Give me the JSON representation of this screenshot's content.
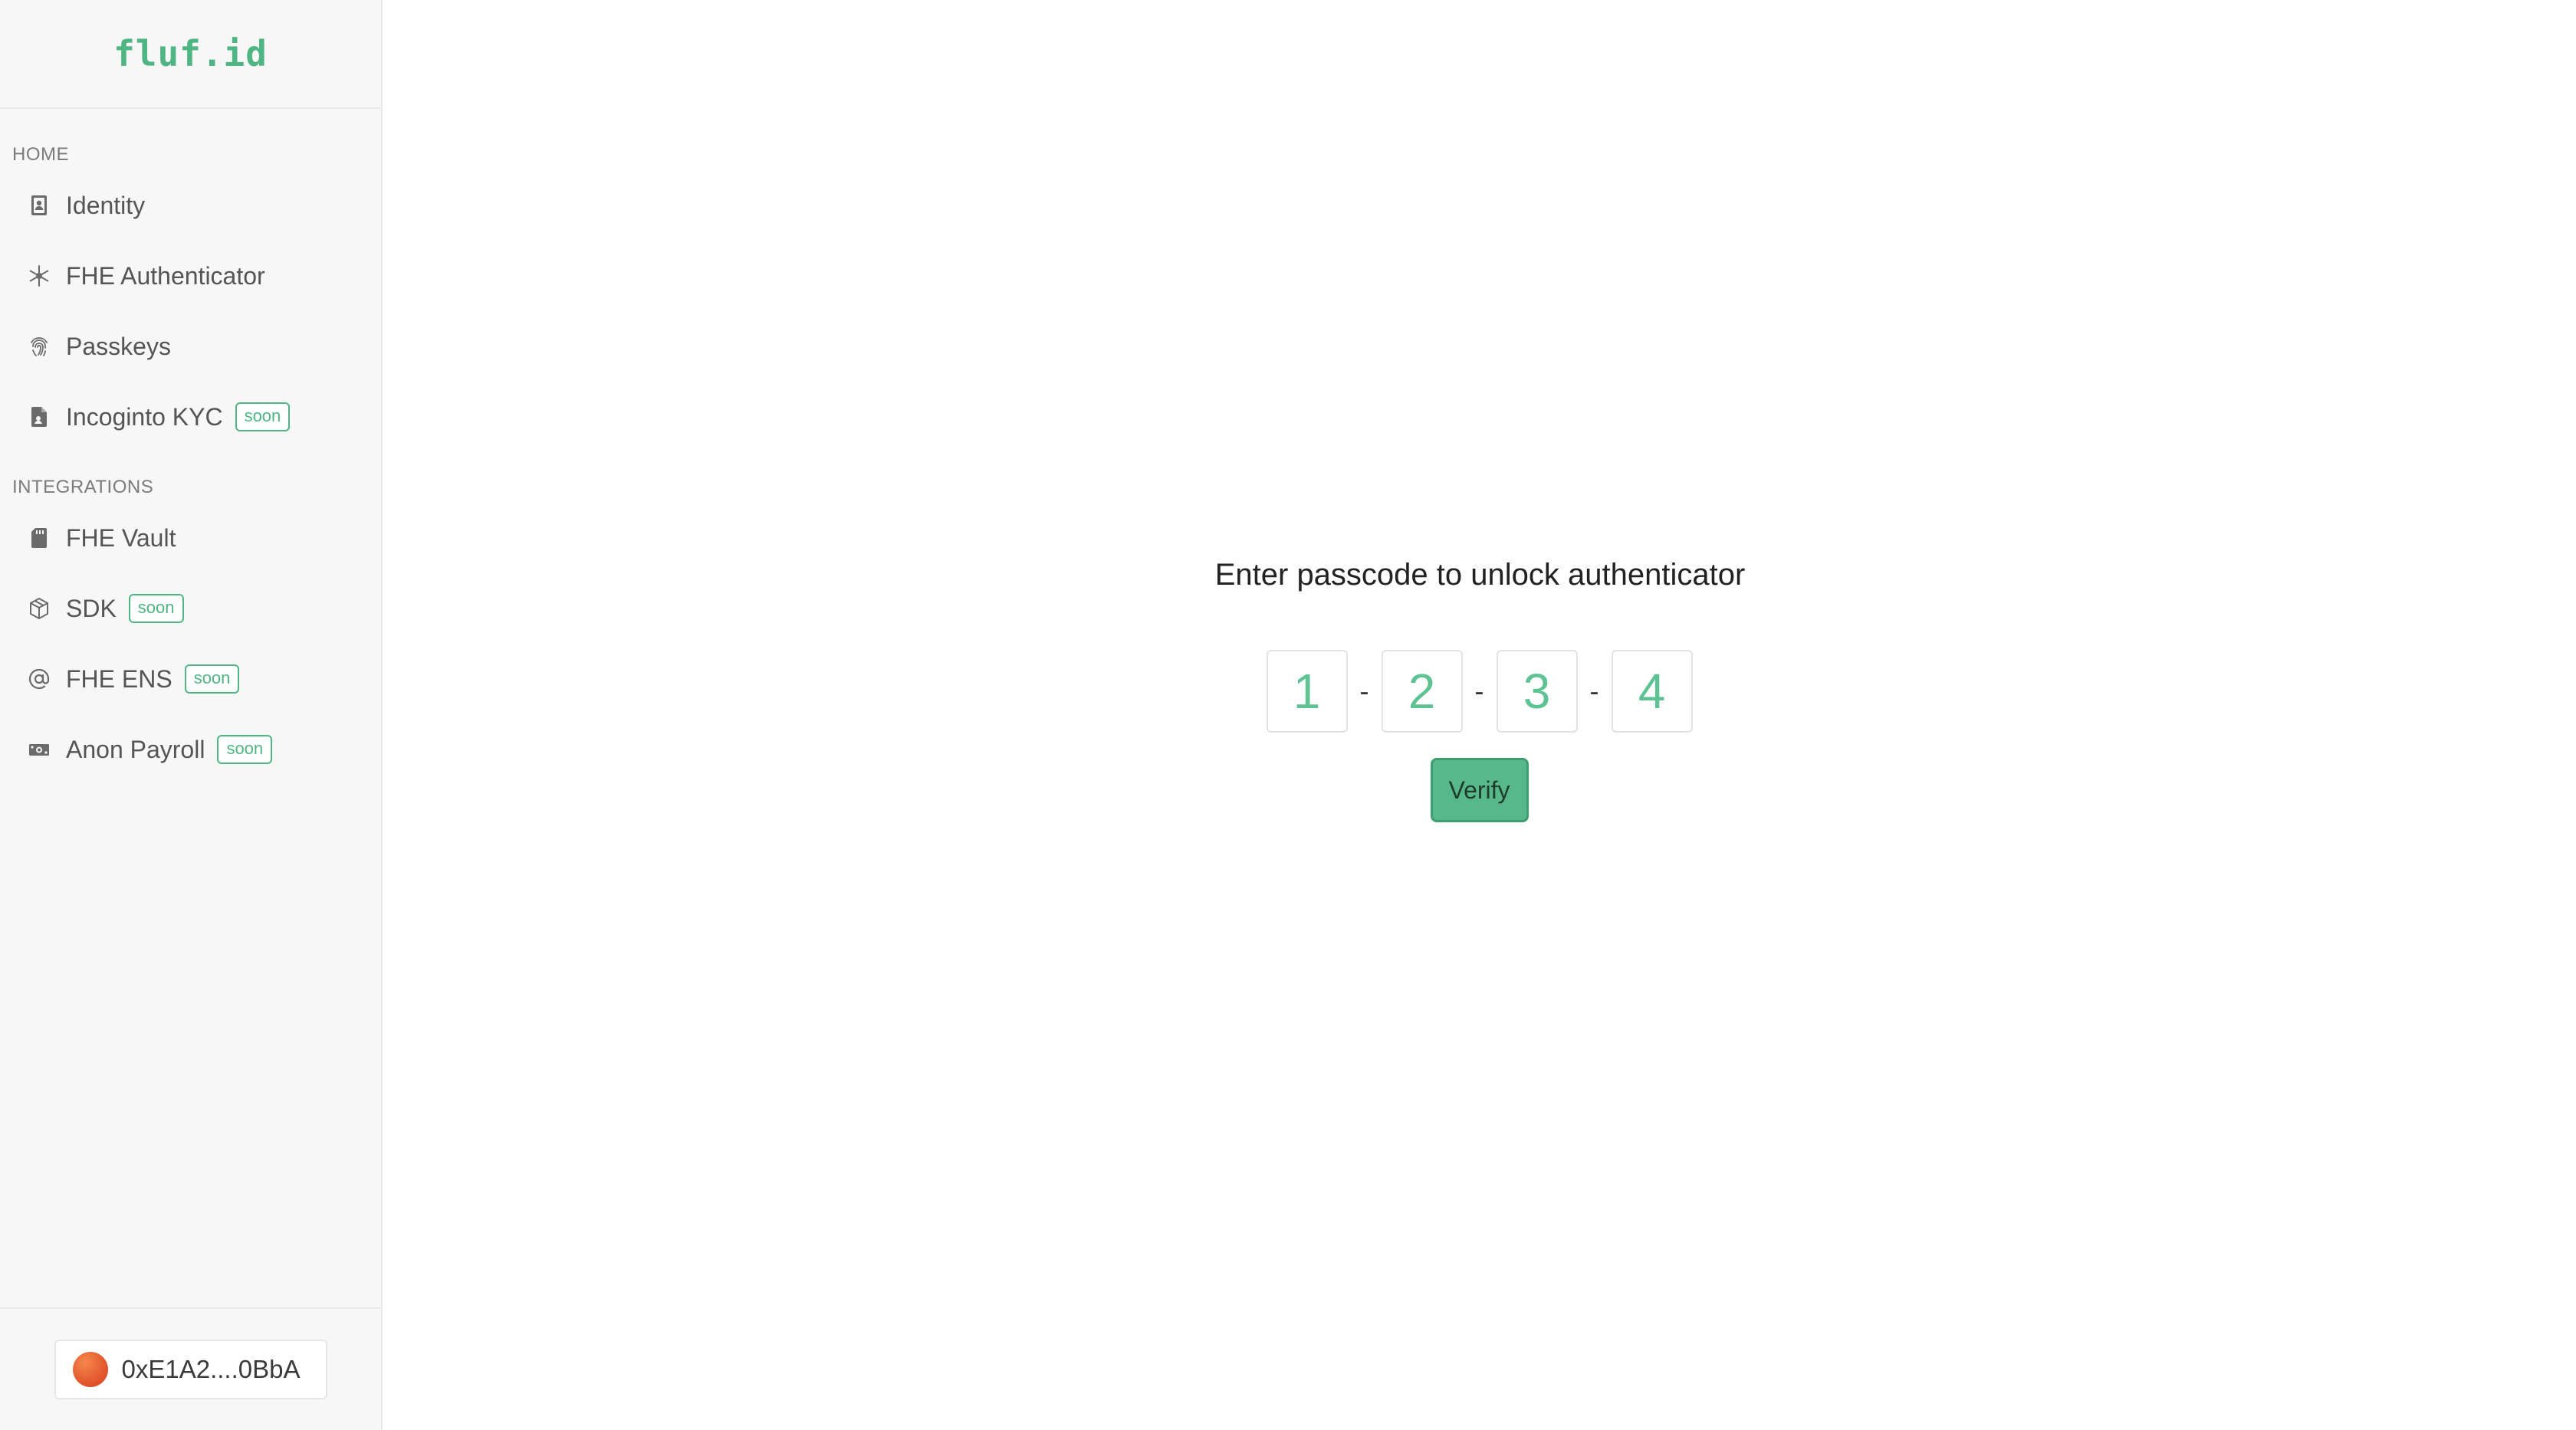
{
  "brand": {
    "logo_text": "fluf.id",
    "accent_color": "#4fb583"
  },
  "sidebar": {
    "sections": [
      {
        "label": "HOME",
        "items": [
          {
            "label": "Identity",
            "icon": "id-card-icon",
            "badge": null
          },
          {
            "label": "FHE Authenticator",
            "icon": "asterisk-icon",
            "badge": null
          },
          {
            "label": "Passkeys",
            "icon": "fingerprint-icon",
            "badge": null
          },
          {
            "label": "Incoginto KYC",
            "icon": "document-icon",
            "badge": "soon"
          }
        ]
      },
      {
        "label": "INTEGRATIONS",
        "items": [
          {
            "label": "FHE Vault",
            "icon": "sd-card-icon",
            "badge": null
          },
          {
            "label": "SDK",
            "icon": "package-icon",
            "badge": "soon"
          },
          {
            "label": "FHE ENS",
            "icon": "at-sign-icon",
            "badge": "soon"
          },
          {
            "label": "Anon Payroll",
            "icon": "cash-icon",
            "badge": "soon"
          }
        ]
      }
    ],
    "wallet": {
      "address": "0xE1A2....0BbA",
      "avatar_color": "#e8612f"
    }
  },
  "main": {
    "prompt": "Enter passcode to unlock authenticator",
    "passcode_digits": [
      "1",
      "2",
      "3",
      "4"
    ],
    "separator": "-",
    "verify_label": "Verify",
    "verify_color": "#57b98a"
  }
}
